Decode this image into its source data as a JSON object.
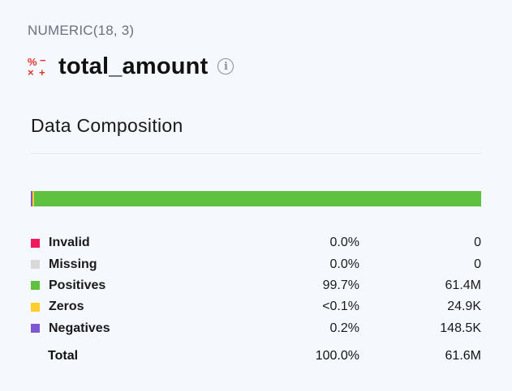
{
  "column": {
    "type": "NUMERIC(18, 3)",
    "name": "total_amount",
    "icon": "numeric-type-icon",
    "info_icon": "info-icon"
  },
  "composition": {
    "title": "Data Composition",
    "rows": [
      {
        "key": "invalid",
        "label": "Invalid",
        "percent": "0.0%",
        "count": "0",
        "color": "#ef1b5c",
        "fraction": 0.0
      },
      {
        "key": "missing",
        "label": "Missing",
        "percent": "0.0%",
        "count": "0",
        "color": "#d9d9d9",
        "fraction": 0.0
      },
      {
        "key": "positives",
        "label": "Positives",
        "percent": "99.7%",
        "count": "61.4M",
        "color": "#5fc13f",
        "fraction": 0.997
      },
      {
        "key": "zeros",
        "label": "Zeros",
        "percent": "<0.1%",
        "count": "24.9K",
        "color": "#ffcd2e",
        "fraction": 0.0004
      },
      {
        "key": "negatives",
        "label": "Negatives",
        "percent": "0.2%",
        "count": "148.5K",
        "color": "#7e57d4",
        "fraction": 0.0024
      }
    ],
    "total": {
      "label": "Total",
      "percent": "100.0%",
      "count": "61.6M"
    }
  }
}
